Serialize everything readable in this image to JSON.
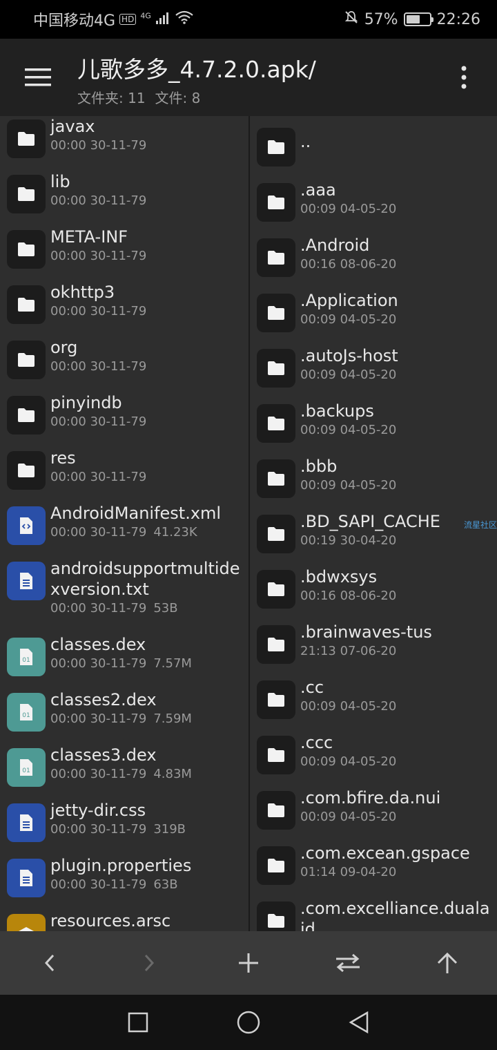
{
  "status_bar": {
    "carrier": "中国移动4G",
    "hd_badge": "HD",
    "signal_label": "4G",
    "battery_percent": "57%",
    "battery_level": 0.57,
    "time": "22:26"
  },
  "app_bar": {
    "title": "儿歌多多_4.7.2.0.apk/",
    "folders_count": "文件夹: 11",
    "files_count": "文件: 8"
  },
  "left_pane": {
    "items": [
      {
        "name": "javax",
        "date": "00:00 30-11-79",
        "size": "",
        "type": "folder"
      },
      {
        "name": "lib",
        "date": "00:00 30-11-79",
        "size": "",
        "type": "folder"
      },
      {
        "name": "META-INF",
        "date": "00:00 30-11-79",
        "size": "",
        "type": "folder"
      },
      {
        "name": "okhttp3",
        "date": "00:00 30-11-79",
        "size": "",
        "type": "folder"
      },
      {
        "name": "org",
        "date": "00:00 30-11-79",
        "size": "",
        "type": "folder"
      },
      {
        "name": "pinyindb",
        "date": "00:00 30-11-79",
        "size": "",
        "type": "folder"
      },
      {
        "name": "res",
        "date": "00:00 30-11-79",
        "size": "",
        "type": "folder"
      },
      {
        "name": "AndroidManifest.xml",
        "date": "00:00 30-11-79",
        "size": "41.23K",
        "type": "xml"
      },
      {
        "name": "androidsupportmultidexversion.txt",
        "date": "00:00 30-11-79",
        "size": "53B",
        "type": "doc"
      },
      {
        "name": "classes.dex",
        "date": "00:00 30-11-79",
        "size": "7.57M",
        "type": "dex"
      },
      {
        "name": "classes2.dex",
        "date": "00:00 30-11-79",
        "size": "7.59M",
        "type": "dex"
      },
      {
        "name": "classes3.dex",
        "date": "00:00 30-11-79",
        "size": "4.83M",
        "type": "dex"
      },
      {
        "name": "jetty-dir.css",
        "date": "00:00 30-11-79",
        "size": "319B",
        "type": "doc"
      },
      {
        "name": "plugin.properties",
        "date": "00:00 30-11-79",
        "size": "63B",
        "type": "doc"
      },
      {
        "name": "resources.arsc",
        "date": "",
        "size": "",
        "type": "arsc"
      }
    ]
  },
  "right_pane": {
    "parent_label": "..",
    "items": [
      {
        "name": ".aaa",
        "date": "00:09 04-05-20"
      },
      {
        "name": ".Android",
        "date": "00:16 08-06-20"
      },
      {
        "name": ".Application",
        "date": "00:09 04-05-20"
      },
      {
        "name": ".autoJs-host",
        "date": "00:09 04-05-20"
      },
      {
        "name": ".backups",
        "date": "00:09 04-05-20"
      },
      {
        "name": ".bbb",
        "date": "00:09 04-05-20"
      },
      {
        "name": ".BD_SAPI_CACHE",
        "date": "00:19 30-04-20"
      },
      {
        "name": ".bdwxsys",
        "date": "00:16 08-06-20"
      },
      {
        "name": ".brainwaves-tus",
        "date": "21:13 07-06-20"
      },
      {
        "name": ".cc",
        "date": "00:09 04-05-20"
      },
      {
        "name": ".ccc",
        "date": "00:09 04-05-20"
      },
      {
        "name": ".com.bfire.da.nui",
        "date": "00:09 04-05-20"
      },
      {
        "name": ".com.excean.gspace",
        "date": "01:14 09-04-20"
      },
      {
        "name": ".com.excelliance.dualaid",
        "date": ""
      }
    ],
    "watermark": "流星社区"
  },
  "icons": {
    "menu": "hamburger-menu-icon",
    "more": "more-vertical-icon",
    "folder": "folder-icon",
    "xml": "code-file-icon",
    "doc": "document-icon",
    "dex": "binary-file-icon",
    "arsc": "archive-icon"
  },
  "colors": {
    "accent_xml": "#2a4fa8",
    "accent_dex": "#4e9a94",
    "accent_arsc": "#b8860b"
  }
}
